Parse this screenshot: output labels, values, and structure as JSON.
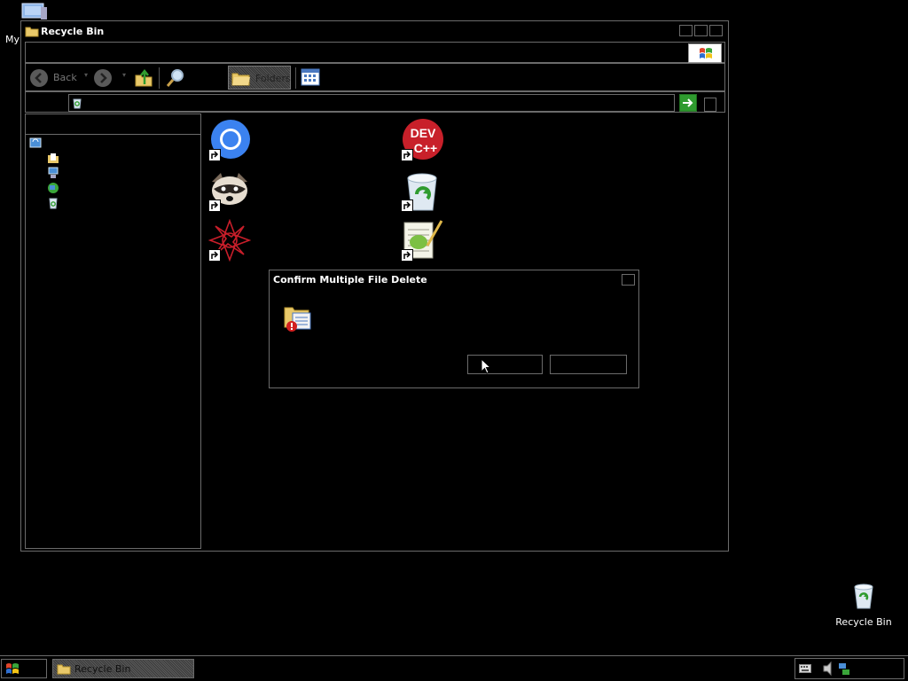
{
  "desktop": {
    "my_computer_label": "My",
    "recycle_bin_label": "Recycle Bin"
  },
  "window": {
    "title": "Recycle Bin",
    "toolbar": {
      "back_label": "Back",
      "folders_label": "Folders"
    },
    "address": {
      "value": ""
    },
    "shortcuts": [
      {
        "icon": "chrome-icon"
      },
      {
        "icon": "devcpp-icon"
      },
      {
        "icon": "raccoon-app-icon"
      },
      {
        "icon": "recycle-bin-icon"
      },
      {
        "icon": "red-starburst-app-icon"
      },
      {
        "icon": "notepad-plus-plus-icon"
      }
    ]
  },
  "dialog": {
    "title": "Confirm Multiple File Delete",
    "message": "",
    "yes_label": "",
    "no_label": ""
  },
  "taskbar": {
    "start_label": "",
    "task_label": "Recycle Bin"
  },
  "colors": {
    "background": "#000000",
    "outline": "#6b6b6b",
    "go_button": "#2f9b2f"
  }
}
